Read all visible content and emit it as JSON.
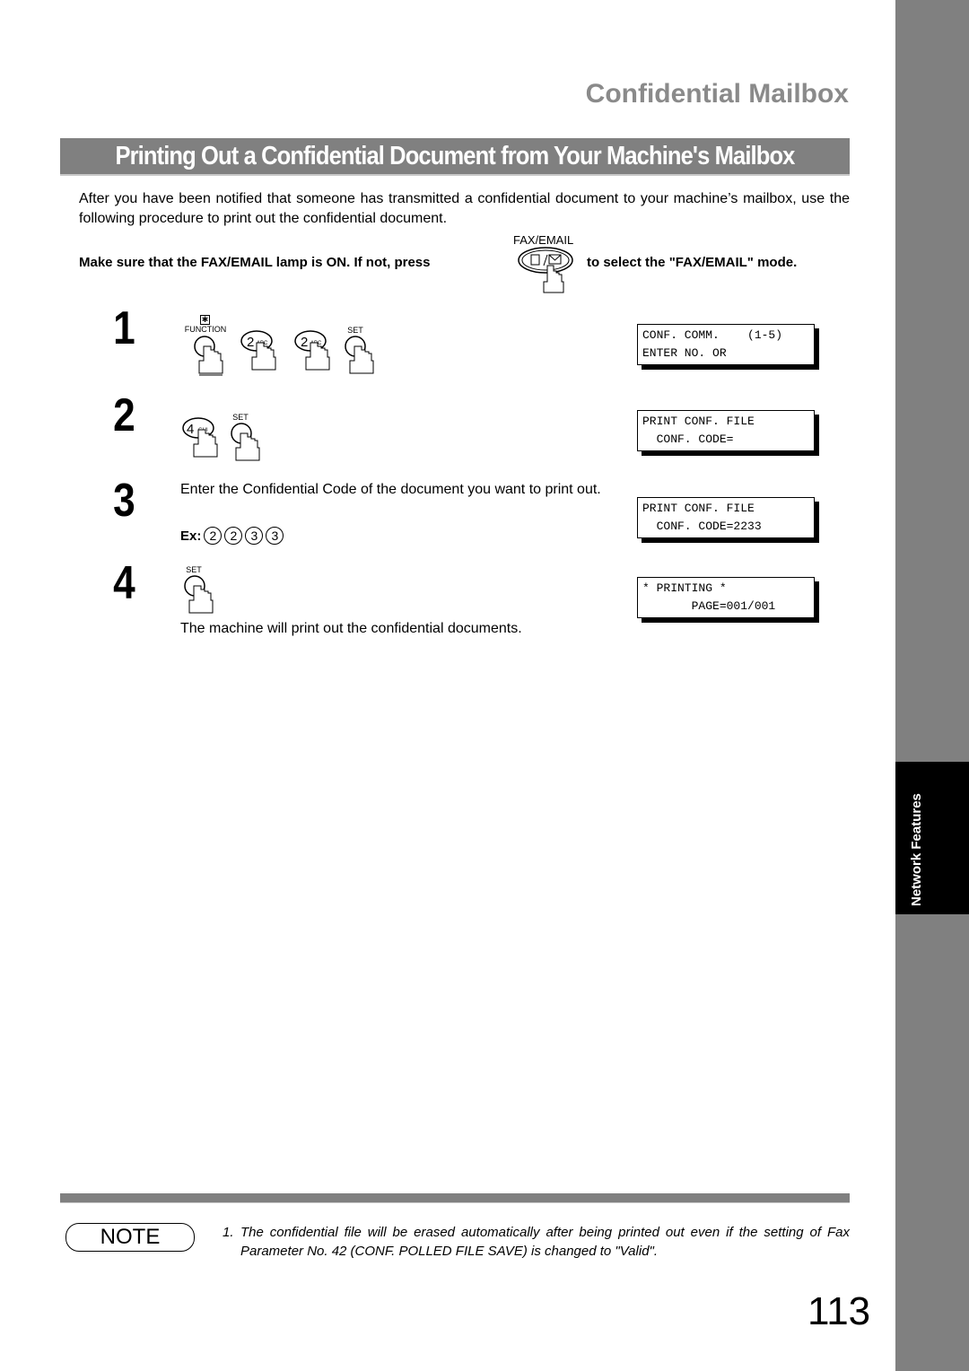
{
  "header": {
    "section_title": "Confidential Mailbox",
    "banner_title": "Printing Out a Confidential Document from Your Machine's Mailbox"
  },
  "intro": "After you have been notified that someone has transmitted a confidential document to your machine’s mailbox, use the following procedure to print out the confidential document.",
  "instruction": {
    "before": "Make sure that the FAX/EMAIL lamp is ON.  If not, press",
    "after": "to select the \"FAX/EMAIL\" mode.",
    "key_label": "FAX/EMAIL"
  },
  "steps": [
    {
      "number": "1",
      "keys": [
        {
          "label": "FUNCTION",
          "glyph": "",
          "icon": "function-key-icon"
        },
        {
          "label": "",
          "glyph": "2",
          "sub": "ABC",
          "icon": "key-2-icon"
        },
        {
          "label": "",
          "glyph": "2",
          "sub": "ABC",
          "icon": "key-2-icon"
        },
        {
          "label": "SET",
          "glyph": "",
          "icon": "set-key-icon"
        }
      ],
      "display": [
        "CONF. COMM.    (1-5)",
        "ENTER NO. OR"
      ]
    },
    {
      "number": "2",
      "keys": [
        {
          "label": "",
          "glyph": "4",
          "sub": "GHI",
          "icon": "key-4-icon"
        },
        {
          "label": "SET",
          "glyph": "",
          "icon": "set-key-icon"
        }
      ],
      "display": [
        "PRINT CONF. FILE",
        "  CONF. CODE="
      ]
    },
    {
      "number": "3",
      "text": "Enter the Confidential Code of the document you want to print out.",
      "example_label": "Ex:",
      "example_digits": [
        "2",
        "2",
        "3",
        "3"
      ],
      "display": [
        "PRINT CONF. FILE",
        "  CONF. CODE=2233"
      ]
    },
    {
      "number": "4",
      "keys": [
        {
          "label": "SET",
          "glyph": "",
          "icon": "set-key-icon"
        }
      ],
      "text": "The machine will print out the confidential documents.",
      "display": [
        "* PRINTING *",
        "       PAGE=001/001"
      ]
    }
  ],
  "note": {
    "badge": "NOTE",
    "items": [
      {
        "num": "1.",
        "text": "The confidential file will be erased automatically after being printed out even if the setting of Fax Parameter No. 42 (CONF. POLLED FILE SAVE) is changed to \"Valid\"."
      }
    ]
  },
  "side_tab": "Network Features",
  "page_number": "113"
}
